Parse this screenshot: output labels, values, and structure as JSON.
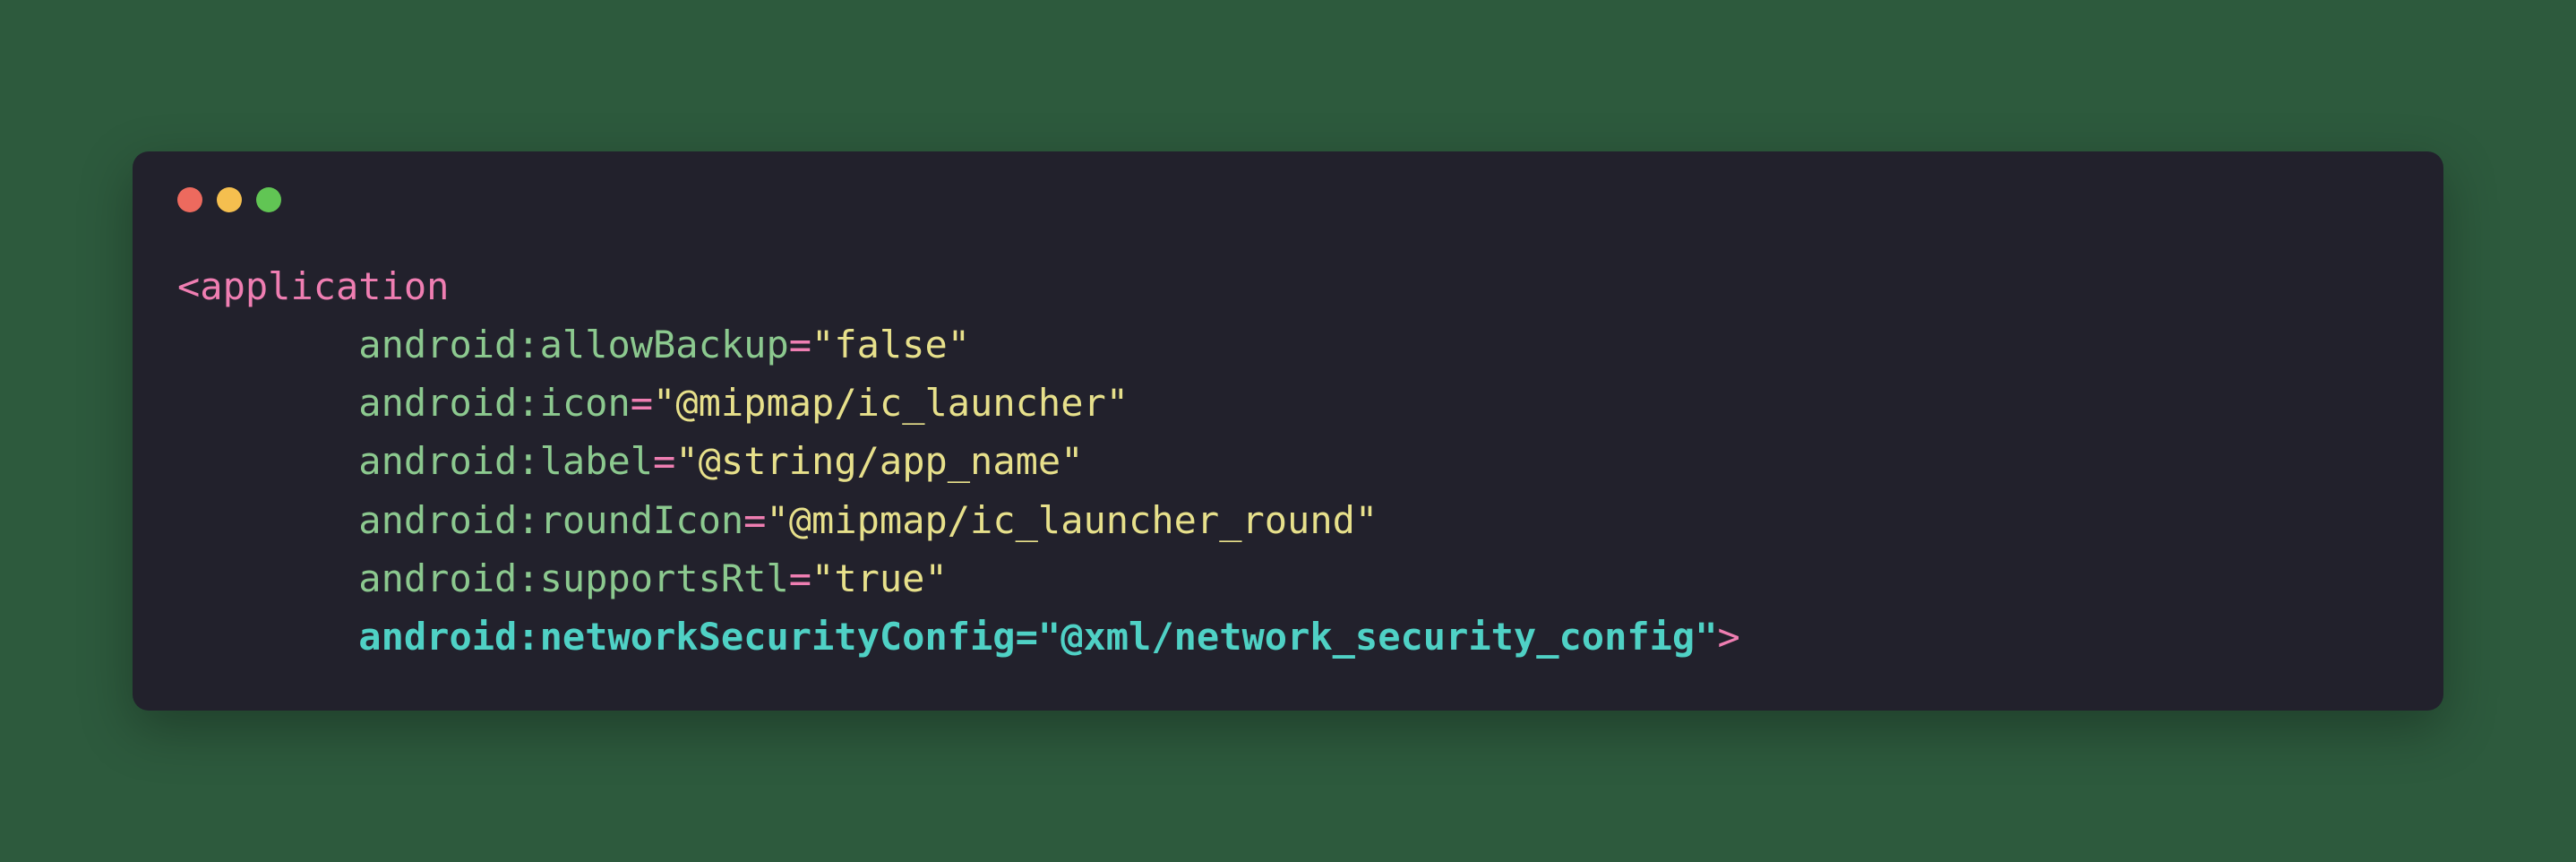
{
  "code": {
    "tag_open": "<",
    "tag_name": "application",
    "tag_close": ">",
    "attributes": [
      {
        "name": "android:allowBackup",
        "value": "false",
        "highlight": false
      },
      {
        "name": "android:icon",
        "value": "@mipmap/ic_launcher",
        "highlight": false
      },
      {
        "name": "android:label",
        "value": "@string/app_name",
        "highlight": false
      },
      {
        "name": "android:roundIcon",
        "value": "@mipmap/ic_launcher_round",
        "highlight": false
      },
      {
        "name": "android:supportsRtl",
        "value": "true",
        "highlight": false
      },
      {
        "name": "android:networkSecurityConfig",
        "value": "@xml/network_security_config",
        "highlight": true
      }
    ],
    "indent": "        ",
    "equals": "=",
    "quote": "\""
  },
  "window": {
    "dots": [
      "red",
      "yellow",
      "green"
    ]
  }
}
